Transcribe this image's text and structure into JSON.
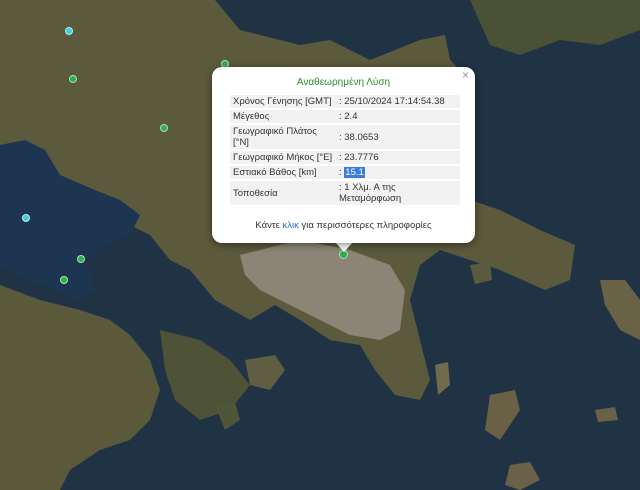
{
  "colors": {
    "sea": "#1f3345",
    "land": "#5b5a3c",
    "urban": "#8c8577",
    "marker_green": "#2bb24c",
    "marker_cyan": "#3fd0e0",
    "title_green": "#2e8b2e",
    "link": "#2a6dc8"
  },
  "popup": {
    "close_glyph": "×",
    "title": "Αναθεωρημένη Λύση",
    "rows": [
      {
        "label": "Χρόνος Γένησης [GMT]",
        "value": ": 25/10/2024 17:14:54.38"
      },
      {
        "label": "Μέγεθος",
        "value": ": 2.4"
      },
      {
        "label": "Γεωγραφικό Πλάτος [°N]",
        "value": ": 38.0653"
      },
      {
        "label": "Γεωγραφικό Μήκος [°E]",
        "value": ": 23.7776"
      },
      {
        "label": "Εστιακό Βάθος [km]",
        "value_prefix": ": ",
        "value_highlight": "15.1"
      },
      {
        "label": "Τοποθεσία",
        "value": ": 1 Χλμ. Α της Μεταμόρφωση"
      }
    ],
    "footer_before": "Κάντε ",
    "footer_link": "κλικ",
    "footer_after": " για περισσότερες πληροφορίες"
  },
  "markers": [
    {
      "name": "event-marker-selected",
      "color": "marker_green"
    },
    {
      "name": "event-marker",
      "color": "marker_cyan"
    }
  ]
}
